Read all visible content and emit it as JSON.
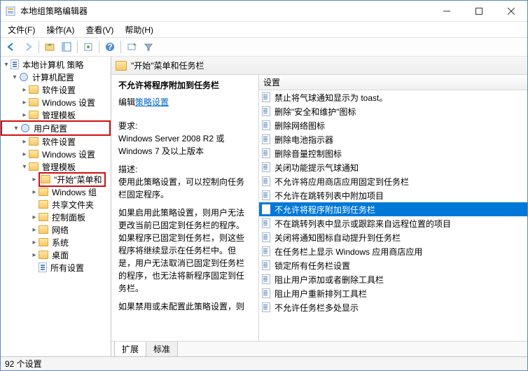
{
  "window": {
    "title": "本地组策略编辑器"
  },
  "menus": {
    "file": "文件(F)",
    "action": "操作(A)",
    "view": "查看(V)",
    "help": "帮助(H)"
  },
  "tree": {
    "root": "本地计算机 策略",
    "computer_config": "计算机配置",
    "cc_software": "软件设置",
    "cc_windows": "Windows 设置",
    "cc_templates": "管理模板",
    "user_config": "用户配置",
    "uc_software": "软件设置",
    "uc_windows": "Windows 设置",
    "uc_templates": "管理模板",
    "start_taskbar": "\"开始\"菜单和",
    "windows_comp": "Windows 组",
    "shared_folders": "共享文件夹",
    "control_panel": "控制面板",
    "network": "网络",
    "system": "系统",
    "desktop": "桌面",
    "all_settings": "所有设置"
  },
  "detail": {
    "header": "\"开始\"菜单和任务栏",
    "title": "不允许将程序附加到任务栏",
    "edit_prefix": "编辑",
    "edit_link": "策略设置",
    "req_label": "要求:",
    "req_body": "Windows Server 2008 R2 或 Windows 7 及以上版本",
    "desc_label": "描述:",
    "desc_1": "使用此策略设置，可以控制向任务栏固定程序。",
    "desc_2": "如果启用此策略设置，则用户无法更改当前已固定到任务栏的程序。如果程序已固定到任务栏，则这些程序将继续显示在任务栏中。但是，用户无法取消已固定到任务栏的程序，也无法将新程序固定到任务栏。",
    "desc_3": "如果禁用或未配置此策略设置，则"
  },
  "list": {
    "column": "设置",
    "items": [
      "禁止将气球通知显示为 toast。",
      "删除\"安全和维护\"图标",
      "删除网络图标",
      "删除电池指示器",
      "删除音量控制图标",
      "关闭功能提示气球通知",
      "不允许将应用商店应用固定到任务栏",
      "不允许在跳转列表中附加项目",
      "不允许将程序附加到任务栏",
      "不在跳转列表中显示或跟踪来自远程位置的项目",
      "关闭将通知图标自动提升到任务栏",
      "在任务栏上显示 Windows 应用商店应用",
      "锁定所有任务栏设置",
      "阻止用户添加或者删除工具栏",
      "阻止用户重新排列工具栏",
      "不允许任务栏多处显示"
    ],
    "selected_index": 8
  },
  "tabs": {
    "extended": "扩展",
    "standard": "标准"
  },
  "status": "92 个设置"
}
